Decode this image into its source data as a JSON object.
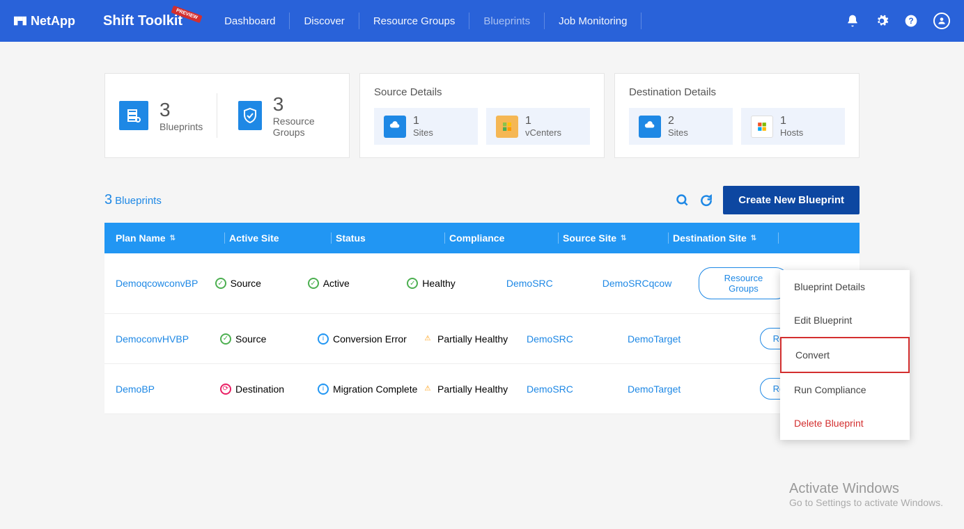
{
  "header": {
    "logo": "NetApp",
    "app_title": "Shift Toolkit",
    "preview_badge": "PREVIEW",
    "nav": [
      "Dashboard",
      "Discover",
      "Resource Groups",
      "Blueprints",
      "Job Monitoring"
    ],
    "active_nav": "Blueprints"
  },
  "summary": {
    "blueprints": {
      "count": "3",
      "label": "Blueprints"
    },
    "resource_groups": {
      "count": "3",
      "label": "Resource Groups"
    },
    "source_details": {
      "title": "Source Details",
      "sites": {
        "count": "1",
        "label": "Sites"
      },
      "vcenters": {
        "count": "1",
        "label": "vCenters"
      }
    },
    "destination_details": {
      "title": "Destination Details",
      "sites": {
        "count": "2",
        "label": "Sites"
      },
      "hosts": {
        "count": "1",
        "label": "Hosts"
      }
    }
  },
  "table": {
    "count": "3",
    "count_label": "Blueprints",
    "create_btn": "Create New Blueprint",
    "columns": [
      "Plan Name",
      "Active Site",
      "Status",
      "Compliance",
      "Source Site",
      "Destination Site"
    ],
    "rows": [
      {
        "plan": "DemoqcowconvBP",
        "site": "Source",
        "site_icon": "ok",
        "status": "Active",
        "status_icon": "ok",
        "compliance": "Healthy",
        "comp_icon": "ok",
        "source": "DemoSRC",
        "dest": "DemoSRCqcow",
        "action": "Resource Groups"
      },
      {
        "plan": "DemoconvHVBP",
        "site": "Source",
        "site_icon": "ok",
        "status": "Conversion Error",
        "status_icon": "info",
        "compliance": "Partially Healthy",
        "comp_icon": "warn",
        "source": "DemoSRC",
        "dest": "DemoTarget",
        "action": "Resource G"
      },
      {
        "plan": "DemoBP",
        "site": "Destination",
        "site_icon": "dest",
        "status": "Migration Complete",
        "status_icon": "info",
        "compliance": "Partially Healthy",
        "comp_icon": "warn",
        "source": "DemoSRC",
        "dest": "DemoTarget",
        "action": "Resource G"
      }
    ]
  },
  "context_menu": {
    "items": [
      "Blueprint Details",
      "Edit Blueprint",
      "Convert",
      "Run Compliance",
      "Delete Blueprint"
    ],
    "highlighted": "Convert",
    "danger": "Delete Blueprint"
  },
  "watermark": {
    "line1": "Activate Windows",
    "line2": "Go to Settings to activate Windows."
  }
}
